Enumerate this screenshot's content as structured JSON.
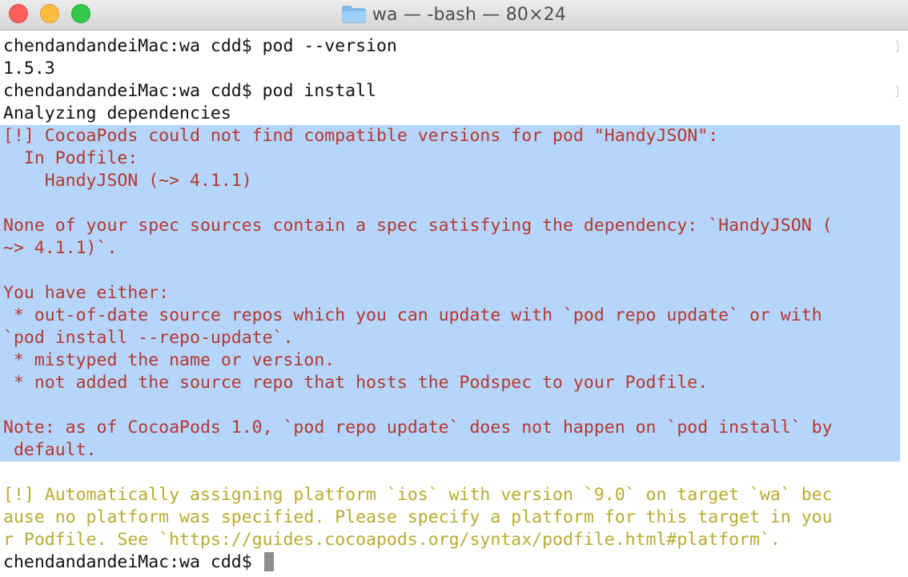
{
  "window": {
    "title": "wa — -bash — 80×24",
    "folder_icon": "folder-icon",
    "buttons": {
      "close": "close-button",
      "minimize": "minimize-button",
      "zoom": "zoom-button"
    }
  },
  "colors": {
    "prompt_text": "#111111",
    "error_text": "#b5382f",
    "warning_text": "#b9ab2f",
    "selection": "#b5d5fb"
  },
  "terminal": {
    "lines": [
      {
        "text": "chendandandeiMac:wa cdd$ pod --version",
        "style": "black"
      },
      {
        "text": "1.5.3",
        "style": "black"
      },
      {
        "text": "chendandandeiMac:wa cdd$ pod install",
        "style": "black"
      },
      {
        "text": "Analyzing dependencies",
        "style": "black"
      },
      {
        "text": "[!] CocoaPods could not find compatible versions for pod \"HandyJSON\":",
        "style": "red"
      },
      {
        "text": "  In Podfile:",
        "style": "red"
      },
      {
        "text": "    HandyJSON (~> 4.1.1)",
        "style": "red"
      },
      {
        "text": "",
        "style": "red"
      },
      {
        "text": "None of your spec sources contain a spec satisfying the dependency: `HandyJSON (",
        "style": "red"
      },
      {
        "text": "~> 4.1.1)`.",
        "style": "red"
      },
      {
        "text": "",
        "style": "red"
      },
      {
        "text": "You have either:",
        "style": "red"
      },
      {
        "text": " * out-of-date source repos which you can update with `pod repo update` or with",
        "style": "red"
      },
      {
        "text": "`pod install --repo-update`.",
        "style": "red"
      },
      {
        "text": " * mistyped the name or version.",
        "style": "red"
      },
      {
        "text": " * not added the source repo that hosts the Podspec to your Podfile.",
        "style": "red"
      },
      {
        "text": "",
        "style": "red"
      },
      {
        "text": "Note: as of CocoaPods 1.0, `pod repo update` does not happen on `pod install` by",
        "style": "red"
      },
      {
        "text": " default.",
        "style": "red"
      },
      {
        "text": "",
        "style": "black"
      },
      {
        "text": "[!] Automatically assigning platform `ios` with version `9.0` on target `wa` bec",
        "style": "yellow"
      },
      {
        "text": "ause no platform was specified. Please specify a platform for this target in you",
        "style": "yellow"
      },
      {
        "text": "r Podfile. See `https://guides.cocoapods.org/syntax/podfile.html#platform`.",
        "style": "yellow"
      },
      {
        "text": "chendandandeiMac:wa cdd$ ",
        "style": "black"
      }
    ]
  }
}
